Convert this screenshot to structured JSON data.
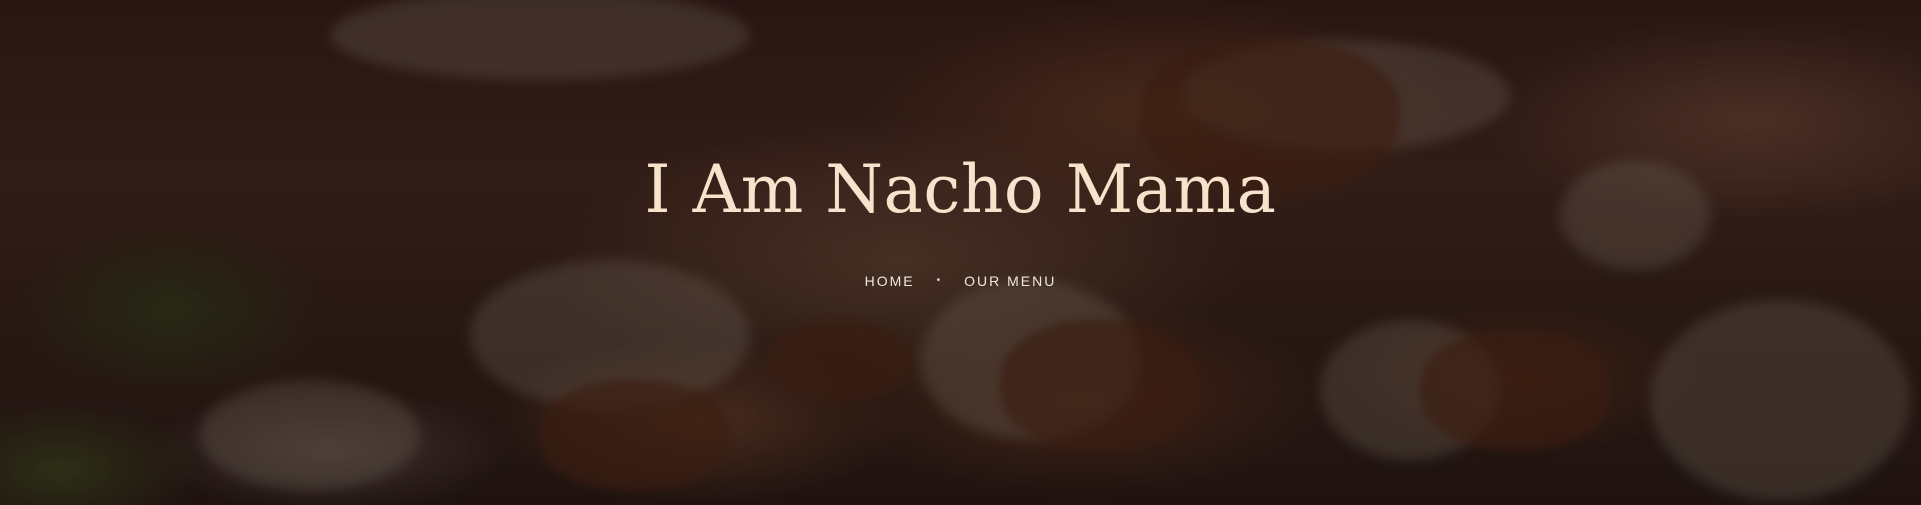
{
  "hero": {
    "title": "I Am Nacho Mama",
    "background_image": "nachos-with-cheese-and-ground-beef"
  },
  "breadcrumb": {
    "items": [
      {
        "label": "HOME"
      },
      {
        "label": "OUR MENU"
      }
    ],
    "separator": "•"
  },
  "colors": {
    "title": "#f7e2cb",
    "breadcrumb_text": "#f1e6dc",
    "overlay": "rgba(20,10,14,0.45)"
  }
}
